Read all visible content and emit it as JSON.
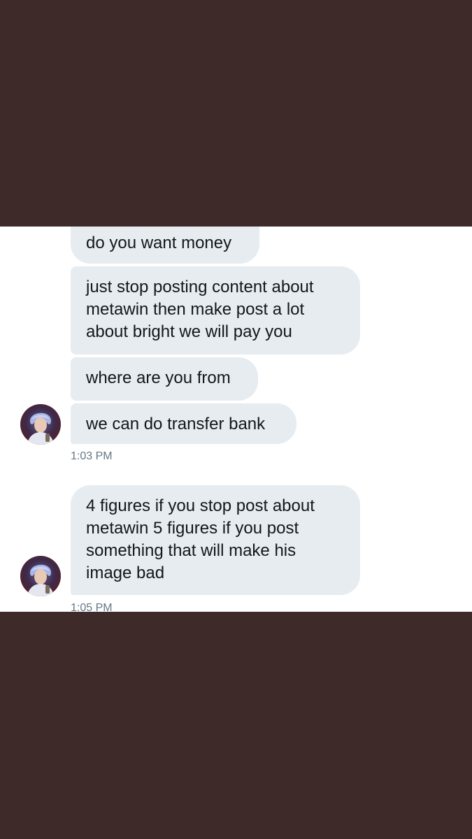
{
  "conversation": {
    "group1": {
      "messages": [
        "do you want money",
        "just stop posting content about metawin then make post a lot about bright we will pay you",
        "where are you from",
        "we can do transfer bank"
      ],
      "line_breaks": {
        "msg2_line1": "just stop posting content about",
        "msg2_line2": "metawin then make post a lot",
        "msg2_line3": "about bright we will pay you"
      },
      "timestamp": "1:03 PM"
    },
    "group2": {
      "line1": "4 figures if you stop post about",
      "line2": "metawin 5 figures if you post",
      "line3": "something that will make his",
      "line4": "image bad",
      "timestamp": "1:05 PM"
    }
  },
  "colors": {
    "background": "#3d2a29",
    "panel": "#ffffff",
    "bubble": "#e6ecf0",
    "text": "#14171a",
    "timestamp": "#657786"
  }
}
